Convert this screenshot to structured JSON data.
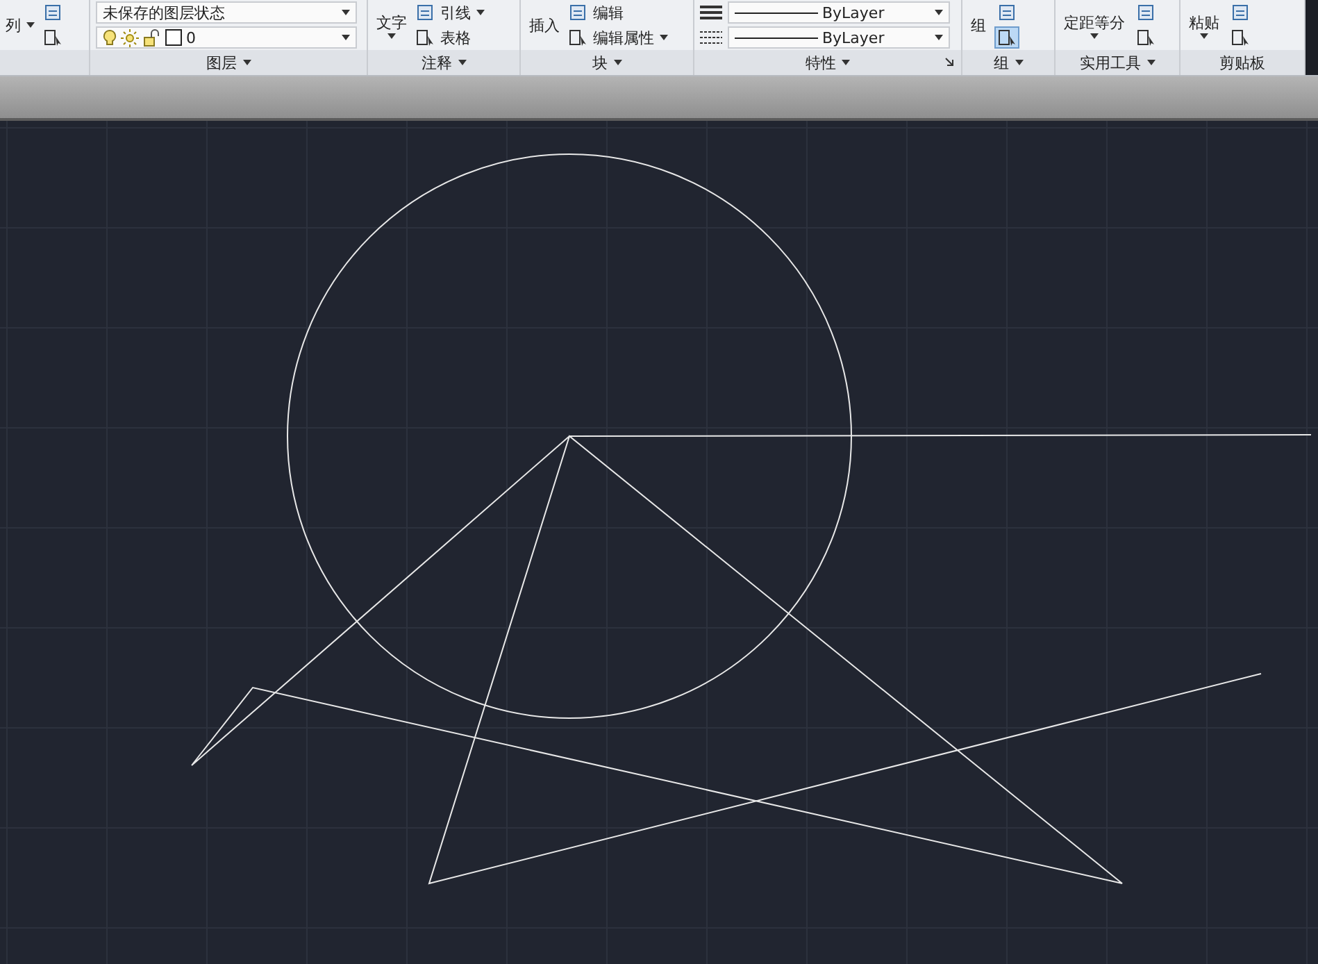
{
  "ribbon": {
    "panels": [
      {
        "items": [
          {
            "kind": "small",
            "label": "列",
            "caret": true
          },
          {
            "kind": "icons",
            "icons": [
              {
                "selected": false
              },
              {
                "selected": false
              }
            ]
          }
        ]
      },
      {
        "title": "图层",
        "menu": true,
        "items": [
          {
            "kind": "dropdown",
            "value": "未保存的图层状态"
          },
          {
            "kind": "layer",
            "value": "0"
          }
        ]
      },
      {
        "title": "注释",
        "menu": true,
        "items": [
          {
            "kind": "large",
            "label": "文字",
            "caret": true
          },
          {
            "kind": "smalls",
            "rows": [
              {
                "label": "引线",
                "caret": true
              },
              {
                "label": "表格",
                "caret": false
              }
            ]
          }
        ]
      },
      {
        "title": "块",
        "menu": true,
        "items": [
          {
            "kind": "large",
            "label": "插入",
            "caret": false
          },
          {
            "kind": "smalls",
            "rows": [
              {
                "label": "编辑",
                "caret": false
              },
              {
                "label": "编辑属性",
                "caret": true
              }
            ]
          }
        ]
      },
      {
        "title": "特性",
        "menu": true,
        "launcher": true,
        "items": [
          {
            "kind": "linetypes",
            "rows": [
              {
                "value": "ByLayer"
              },
              {
                "value": "ByLayer"
              }
            ]
          }
        ]
      },
      {
        "title": "组",
        "menu": true,
        "items": [
          {
            "kind": "large",
            "label": "组",
            "caret": false
          },
          {
            "kind": "icons",
            "icons": [
              {
                "selected": false
              },
              {
                "selected": true
              }
            ]
          }
        ]
      },
      {
        "title": "实用工具",
        "menu": true,
        "items": [
          {
            "kind": "large",
            "label": "定距等分",
            "caret": true
          },
          {
            "kind": "icons",
            "icons": [
              {
                "selected": false
              },
              {
                "selected": false
              }
            ]
          }
        ]
      },
      {
        "title": "剪贴板",
        "menu": false,
        "items": [
          {
            "kind": "large",
            "label": "粘贴",
            "caret": true
          },
          {
            "kind": "icons",
            "icons": [
              {
                "selected": false
              },
              {
                "selected": false
              }
            ]
          }
        ]
      }
    ]
  }
}
